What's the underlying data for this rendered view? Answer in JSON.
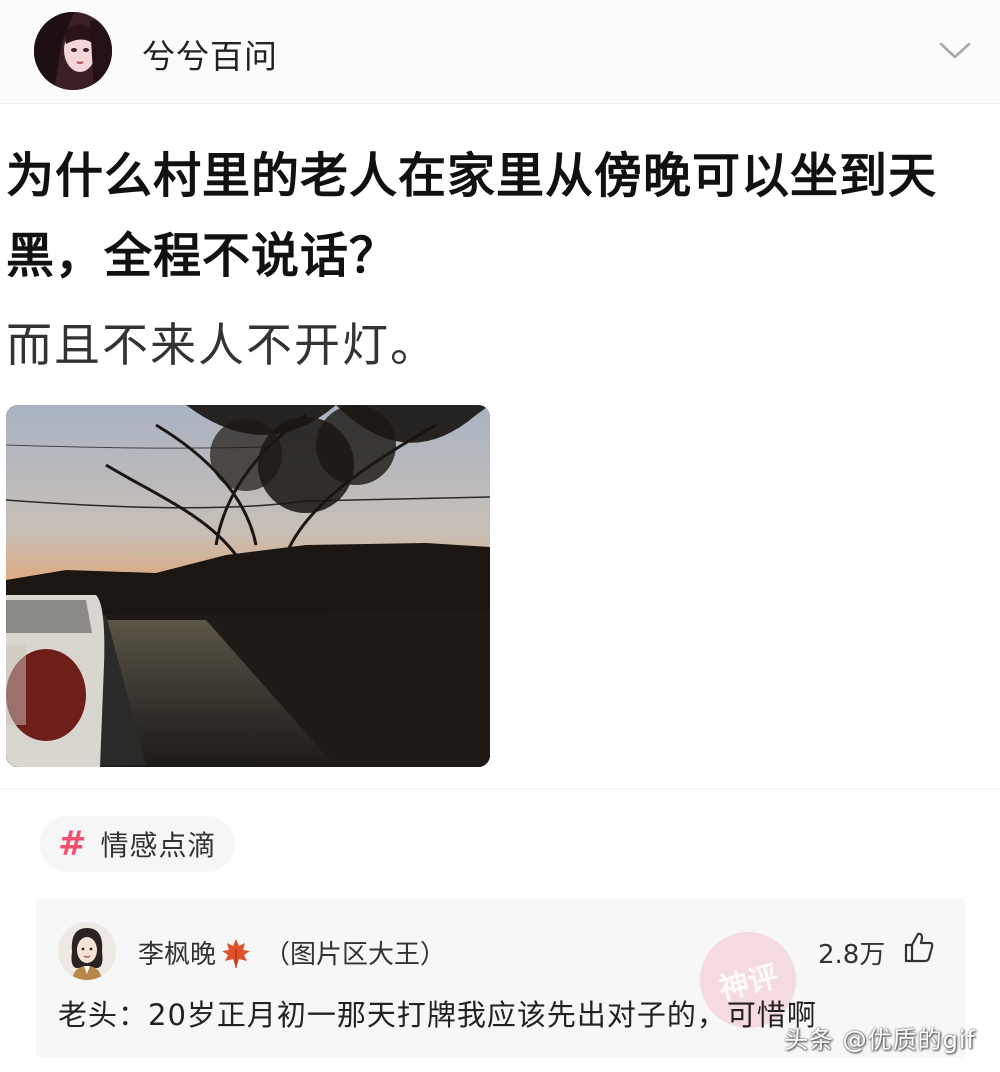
{
  "header": {
    "author_name": "兮兮百问",
    "avatar_icon": "user-avatar",
    "menu_icon": "chevron-down-icon"
  },
  "post": {
    "title": "为什么村里的老人在家里从傍晚可以坐到天黑，全程不说话？",
    "subtitle": "而且不来人不开灯。",
    "image_icon": "dusk-village-photo"
  },
  "topic": {
    "hash": "#",
    "label": "情感点滴"
  },
  "comment": {
    "user_name": "李枫晚",
    "user_badge_icon": "maple-leaf-icon",
    "user_tag": "（图片区大王）",
    "likes": "2.8万",
    "like_icon": "thumbs-up-icon",
    "text": "老头：20岁正月初一那天打牌我应该先出对子的，可惜啊",
    "stamp": "神评"
  },
  "watermark": "头条 @优质的gif",
  "colors": {
    "tag_accent": "#f0506e",
    "comment_bg": "#f7f7f7"
  }
}
